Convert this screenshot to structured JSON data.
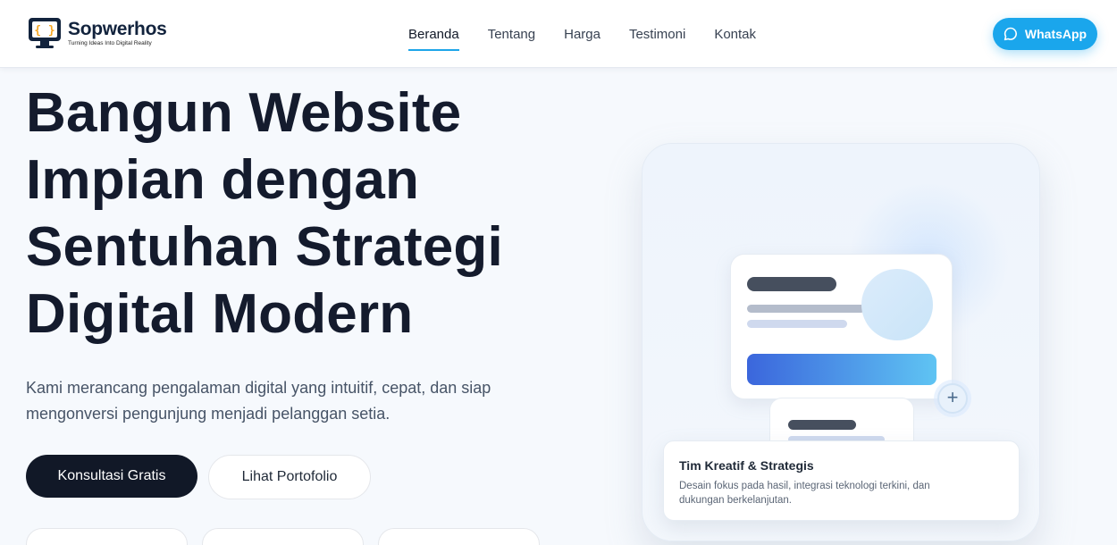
{
  "brand": {
    "name": "Sopwerhos",
    "tagline": "Turning Ideas Into Digital Reality",
    "logo_icon": "monitor-braces-icon"
  },
  "nav": {
    "items": [
      {
        "label": "Beranda",
        "active": true
      },
      {
        "label": "Tentang",
        "active": false
      },
      {
        "label": "Harga",
        "active": false
      },
      {
        "label": "Testimoni",
        "active": false
      },
      {
        "label": "Kontak",
        "active": false
      }
    ]
  },
  "whatsapp": {
    "label": "WhatsApp",
    "icon": "chat-bubble-icon",
    "color": "#1aa6ec"
  },
  "hero": {
    "title_lines": [
      "Bangun Website",
      "Impian dengan",
      "Sentuhan Strategi",
      "Digital Modern"
    ],
    "subtitle_lines": [
      "Kami merancang pengalaman digital yang intuitif, cepat, dan siap",
      "mengonversi pengunjung menjadi pelanggan setia."
    ],
    "primary_cta": "Konsultasi Gratis",
    "secondary_cta": "Lihat Portofolio"
  },
  "illustration": {
    "card_title": "Tim Kreatif & Strategis",
    "card_desc_lines": [
      "Desain fokus pada hasil, integrasi teknologi terkini, dan",
      "dukungan berkelanjutan."
    ],
    "plus_icon": "plus-icon"
  },
  "colors": {
    "accent": "#1ea5e9",
    "dark": "#111827",
    "title": "#141b2d"
  }
}
